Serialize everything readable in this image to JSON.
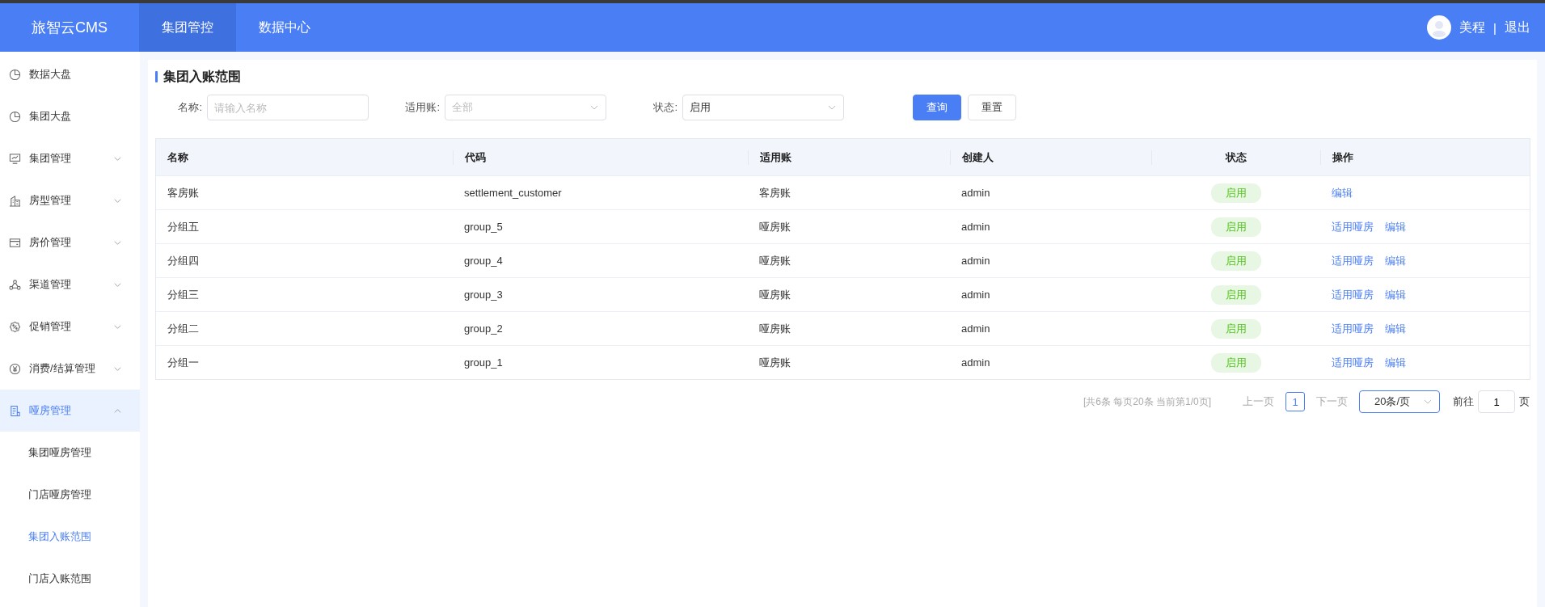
{
  "header": {
    "logo": "旅智云CMS",
    "tabs": [
      {
        "label": "集团管控",
        "selected": true
      },
      {
        "label": "数据中心",
        "selected": false
      }
    ],
    "user": "美程",
    "separator": "|",
    "logout": "退出"
  },
  "sidebar": {
    "items": [
      {
        "label": "数据大盘",
        "kind": "link",
        "selected": false
      },
      {
        "label": "集团大盘",
        "kind": "link",
        "selected": false
      },
      {
        "label": "集团管理",
        "kind": "group",
        "expanded": false,
        "selected": false
      },
      {
        "label": "房型管理",
        "kind": "group",
        "expanded": false,
        "selected": false
      },
      {
        "label": "房价管理",
        "kind": "group",
        "expanded": false,
        "selected": false
      },
      {
        "label": "渠道管理",
        "kind": "group",
        "expanded": false,
        "selected": false
      },
      {
        "label": "促销管理",
        "kind": "group",
        "expanded": false,
        "selected": false
      },
      {
        "label": "消费/结算管理",
        "kind": "group",
        "expanded": false,
        "selected": false
      },
      {
        "label": "哑房管理",
        "kind": "group",
        "expanded": true,
        "selected": true,
        "children": [
          {
            "label": "集团哑房管理",
            "selected": false
          },
          {
            "label": "门店哑房管理",
            "selected": false
          },
          {
            "label": "集团入账范围",
            "selected": true
          },
          {
            "label": "门店入账范围",
            "selected": false
          }
        ]
      }
    ]
  },
  "page": {
    "title": "集团入账范围"
  },
  "filters": [
    {
      "label": "名称:",
      "kind": "input",
      "placeholder": "请输入名称"
    },
    {
      "label": "适用账:",
      "kind": "select",
      "placeholder": "全部"
    },
    {
      "label": "状态:",
      "kind": "select",
      "value": "启用"
    }
  ],
  "buttons": [
    {
      "label": "查询",
      "kind": "primary"
    },
    {
      "label": "重置",
      "kind": "default"
    }
  ],
  "table": {
    "columns": [
      "名称",
      "代码",
      "适用账",
      "创建人",
      "状态",
      "操作"
    ],
    "rows": [
      {
        "name": "客房账",
        "code": "settlement_customer",
        "account": "客房账",
        "creator": "admin",
        "status": "启用",
        "actions": [
          "编辑"
        ]
      },
      {
        "name": "分组五",
        "code": "group_5",
        "account": "哑房账",
        "creator": "admin",
        "status": "启用",
        "actions": [
          "适用哑房",
          "编辑"
        ]
      },
      {
        "name": "分组四",
        "code": "group_4",
        "account": "哑房账",
        "creator": "admin",
        "status": "启用",
        "actions": [
          "适用哑房",
          "编辑"
        ]
      },
      {
        "name": "分组三",
        "code": "group_3",
        "account": "哑房账",
        "creator": "admin",
        "status": "启用",
        "actions": [
          "适用哑房",
          "编辑"
        ]
      },
      {
        "name": "分组二",
        "code": "group_2",
        "account": "哑房账",
        "creator": "admin",
        "status": "启用",
        "actions": [
          "适用哑房",
          "编辑"
        ]
      },
      {
        "name": "分组一",
        "code": "group_1",
        "account": "哑房账",
        "creator": "admin",
        "status": "启用",
        "actions": [
          "适用哑房",
          "编辑"
        ]
      }
    ]
  },
  "pagination": {
    "summary": "[共6条 每页20条 当前第1/0页]",
    "prev": "上一页",
    "pages": [
      {
        "label": "1",
        "selected": true
      }
    ],
    "next": "下一页",
    "page_size": "20条/页",
    "goto_label": "前往",
    "goto_value": "1",
    "goto_unit": "页"
  }
}
